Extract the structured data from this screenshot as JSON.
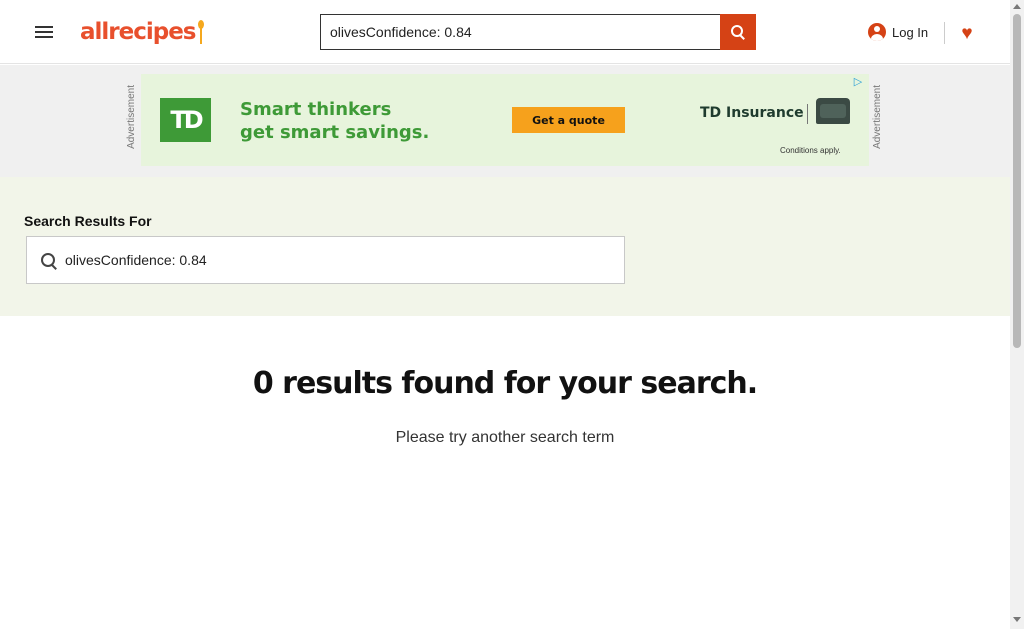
{
  "header": {
    "menu_icon": "hamburger-icon",
    "logo_text": "allrecipes",
    "search_value": "olivesConfidence: 0.84",
    "search_icon": "search-icon",
    "login_label": "Log In",
    "user_icon": "user-icon",
    "saved_icon": "heart-icon",
    "saved_glyph": "♥"
  },
  "advertisement": {
    "label": "Advertisement",
    "sponsor_logo_text": "TD",
    "headline_line1": "Smart thinkers",
    "headline_line2": "get smart savings.",
    "cta_label": "Get a quote",
    "brand": "TD Insurance",
    "fine_print": "Conditions apply.",
    "adchoices_glyph": "▷",
    "colors": {
      "green": "#3e9a37",
      "cta": "#f6a11c",
      "background": "#e7f4dc"
    }
  },
  "search_results": {
    "heading": "Search Results For",
    "query_value": "olivesConfidence: 0.84"
  },
  "empty_state": {
    "title": "0 results found for your search.",
    "subtitle": "Please try another search term"
  },
  "colors": {
    "brand": "#e8502d",
    "search_button": "#d54215",
    "results_band": "#f2f5e9"
  }
}
